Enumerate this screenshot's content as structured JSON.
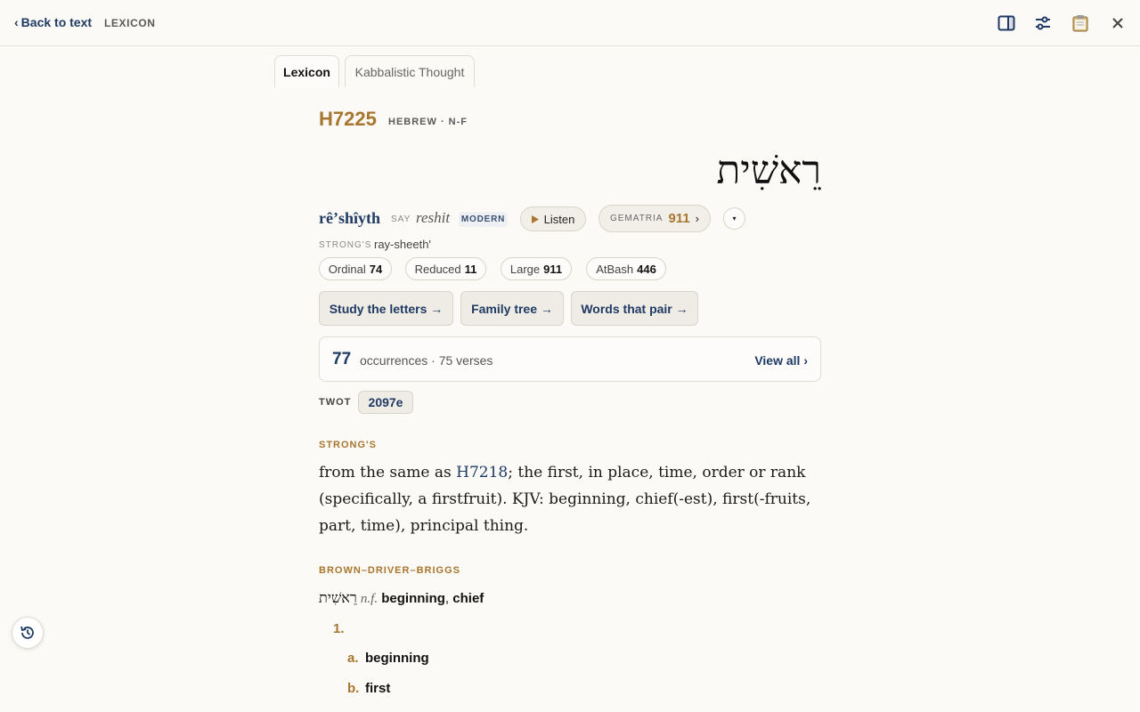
{
  "header": {
    "back_label": "Back to text",
    "back_chevron": "‹",
    "title": "LEXICON",
    "icons": [
      "panel-icon",
      "sliders-icon",
      "clipboard-icon",
      "close-icon"
    ]
  },
  "tabs": [
    {
      "label": "Lexicon",
      "active": true
    },
    {
      "label": "Kabbalistic Thought",
      "active": false
    }
  ],
  "entry": {
    "strongs_number": "H7225",
    "language_meta": "HEBREW · N-F",
    "hebrew": "רֵאשִׁית",
    "transliteration": "rêʼshîyth",
    "say_label": "SAY",
    "say_value": "reshit",
    "modern_badge": "MODERN",
    "listen_label": "Listen",
    "gematria_label": "GEMATRIA",
    "gematria_value": "911",
    "gematria_chevron": "›",
    "more_caret": "▾",
    "strongs_pron_label": "STRONG'S",
    "strongs_pron": "ray-sheeth'"
  },
  "number_pills": [
    {
      "label": "Ordinal",
      "value": "74"
    },
    {
      "label": "Reduced",
      "value": "11"
    },
    {
      "label": "Large",
      "value": "911"
    },
    {
      "label": "AtBash",
      "value": "446"
    }
  ],
  "actions": [
    {
      "label": "Study the letters →"
    },
    {
      "label": "Family tree →"
    },
    {
      "label": "Words that pair →"
    }
  ],
  "occurrences": {
    "count": "77",
    "text": "occurrences · 75 verses",
    "view_all": "View all ›"
  },
  "twot": {
    "label": "TWOT",
    "value": "2097e"
  },
  "strongs_section": {
    "label": "STRONG'S",
    "before": "from the same as ",
    "link": "H7218",
    "after": "; the first, in place, time, order or rank (specifically, a firstfruit). KJV: beginning, chief(-est), first(-fruits, part, time), principal thing."
  },
  "bdb_section": {
    "label": "BROWN–DRIVER–BRIGGS",
    "hebrew": "רֵאשִׁית",
    "pos": "n.f.",
    "gloss_1": "beginning",
    "comma": ",",
    "gloss_2": "chief",
    "items": [
      {
        "num": "1.",
        "text": ""
      },
      {
        "num": "a.",
        "text": "beginning"
      },
      {
        "num": "b.",
        "text": "first"
      }
    ]
  },
  "colors": {
    "accent_gold": "#a8762e",
    "accent_navy": "#1f3a63",
    "background": "#fbfaf7"
  }
}
